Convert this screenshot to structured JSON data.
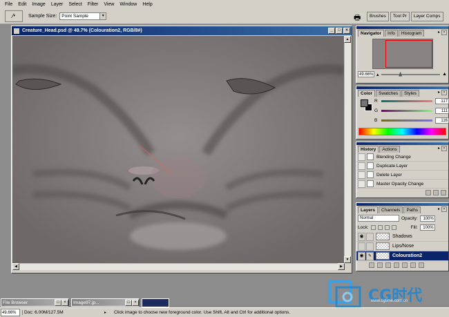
{
  "menubar": [
    "File",
    "Edit",
    "Image",
    "Layer",
    "Select",
    "Filter",
    "View",
    "Window",
    "Help"
  ],
  "options": {
    "sample_size_label": "Sample Size:",
    "sample_size_value": "Point Sample"
  },
  "palette_well": [
    "Brushes",
    "Tool Pr",
    "Layer Comps"
  ],
  "document": {
    "title": "Creature_Head.psd @ 49.7% (Colouration2, RGB/8#)"
  },
  "navigator": {
    "tabs": [
      "Navigator",
      "Info",
      "Histogram"
    ],
    "zoom": "49.66%"
  },
  "color": {
    "tabs": [
      "Color",
      "Swatches",
      "Styles"
    ],
    "channels": [
      {
        "label": "R",
        "value": "117"
      },
      {
        "label": "G",
        "value": "111"
      },
      {
        "label": "B",
        "value": "116"
      }
    ],
    "foreground": "#757374",
    "background": "#000000"
  },
  "history": {
    "tabs": [
      "History",
      "Actions"
    ],
    "items": [
      "Blending Change",
      "Duplicate Layer",
      "Delete Layer",
      "Master Opacity Change"
    ]
  },
  "layers": {
    "tabs": [
      "Layers",
      "Channels",
      "Paths"
    ],
    "mode": "Normal",
    "opacity_label": "Opacity:",
    "opacity": "100%",
    "lock_label": "Lock:",
    "fill_label": "Fill:",
    "fill": "100%",
    "items": [
      {
        "name": "Shadows",
        "active": false
      },
      {
        "name": "Lips/Nose",
        "active": false
      },
      {
        "name": "Colouration2",
        "active": true
      }
    ]
  },
  "taskbar": {
    "file_browser": "File Browser",
    "image_doc": "Image97.jp..."
  },
  "status": {
    "zoom": "49.66%",
    "doc": "Doc: 6.00M/127.5M",
    "message": "Click image to choose new foreground color. Use Shift, Alt and Ctrl for additional options."
  },
  "watermark": {
    "brand": "CG时代",
    "url": "www.cgtime.com.cn"
  }
}
